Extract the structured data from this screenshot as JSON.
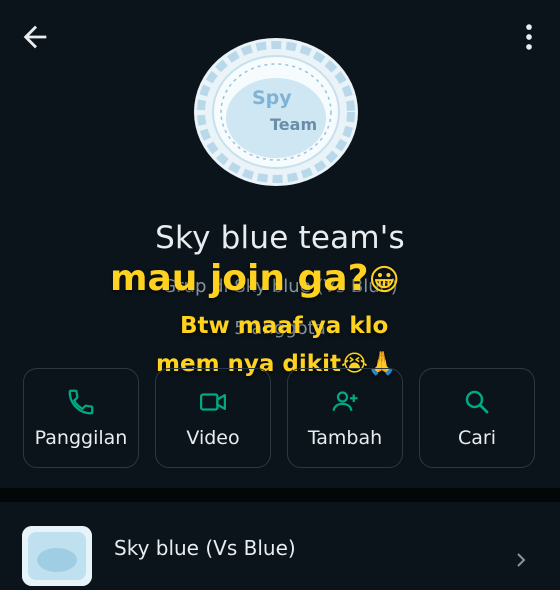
{
  "header": {
    "back_icon": "arrow-left-icon",
    "menu_icon": "more-vertical-icon"
  },
  "profile": {
    "avatar_text_line1": "Spy",
    "avatar_text_line2": "Team",
    "name": "Sky blue team's",
    "subtitle": "Grup di Sky blue (Vs Blue)",
    "members": "5 anggota"
  },
  "overlay": {
    "line1": "mau join ga?",
    "line2": "Btw maaf ya klo",
    "line3": "mem nya dikit",
    "emoji1": "😀",
    "emoji2": "😭🙏"
  },
  "actions": [
    {
      "label": "Panggilan",
      "icon": "phone-icon"
    },
    {
      "label": "Video",
      "icon": "video-icon"
    },
    {
      "label": "Tambah",
      "icon": "add-person-icon"
    },
    {
      "label": "Cari",
      "icon": "search-icon"
    }
  ],
  "community": {
    "title": "Sky blue (Vs Blue)"
  },
  "colors": {
    "background": "#0b141a",
    "accent": "#00a884",
    "sticker_text": "#ffd21f"
  }
}
